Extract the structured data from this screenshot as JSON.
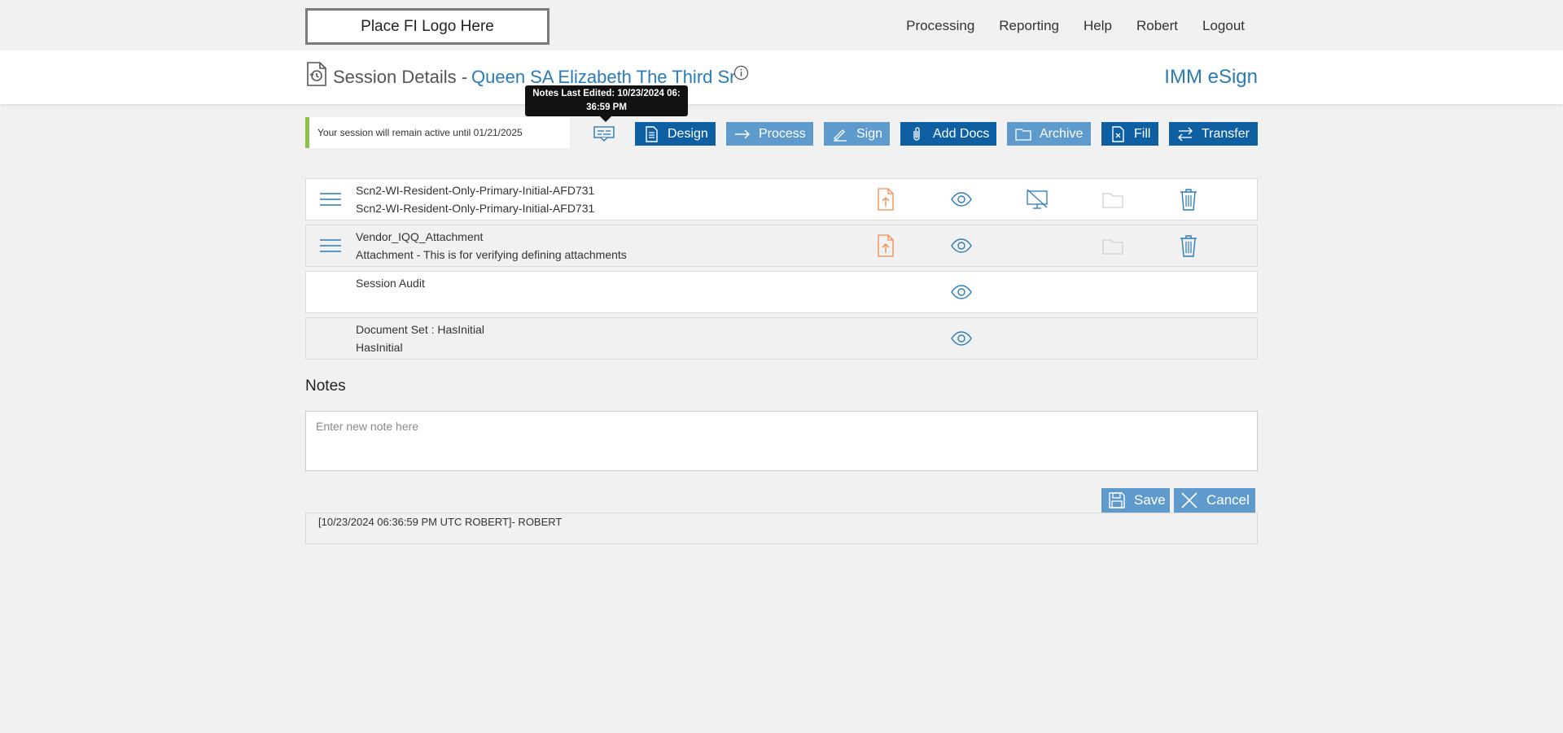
{
  "logo": {
    "text": "Place FI Logo Here"
  },
  "nav": {
    "items": [
      "Processing",
      "Reporting",
      "Help",
      "Robert",
      "Logout"
    ]
  },
  "header": {
    "title": "Session Details -",
    "session_name": "Queen SA Elizabeth The Third Sr",
    "brand": "IMM eSign"
  },
  "session": {
    "message": "Your session will remain active until 01/21/2025",
    "tooltip_line1": "Notes Last Edited: 10/23/2024 06:",
    "tooltip_line2": "36:59 PM"
  },
  "actions": {
    "design": "Design",
    "process": "Process",
    "sign": "Sign",
    "add_docs": "Add Docs",
    "archive": "Archive",
    "fill": "Fill",
    "transfer": "Transfer"
  },
  "documents": [
    {
      "line1": "Scn2-WI-Resident-Only-Primary-Initial-AFD731",
      "line2": "Scn2-WI-Resident-Only-Primary-Initial-AFD731"
    },
    {
      "line1": "Vendor_IQQ_Attachment",
      "line2": "Attachment - This is for verifying defining attachments"
    },
    {
      "line1": "Session Audit",
      "line2": ""
    },
    {
      "line1": "Document Set : HasInitial",
      "line2": "HasInitial"
    }
  ],
  "notes": {
    "title": "Notes",
    "placeholder": "Enter new note here",
    "save": "Save",
    "cancel": "Cancel",
    "entry": "[10/23/2024 06:36:59 PM UTC ROBERT]- ROBERT"
  },
  "colors": {
    "primary": "#0f5fa3",
    "secondary": "#5e9bcc",
    "accent_orange": "#f08a4b",
    "link_blue": "#2b7bb8",
    "active_green": "#8bc34a"
  }
}
